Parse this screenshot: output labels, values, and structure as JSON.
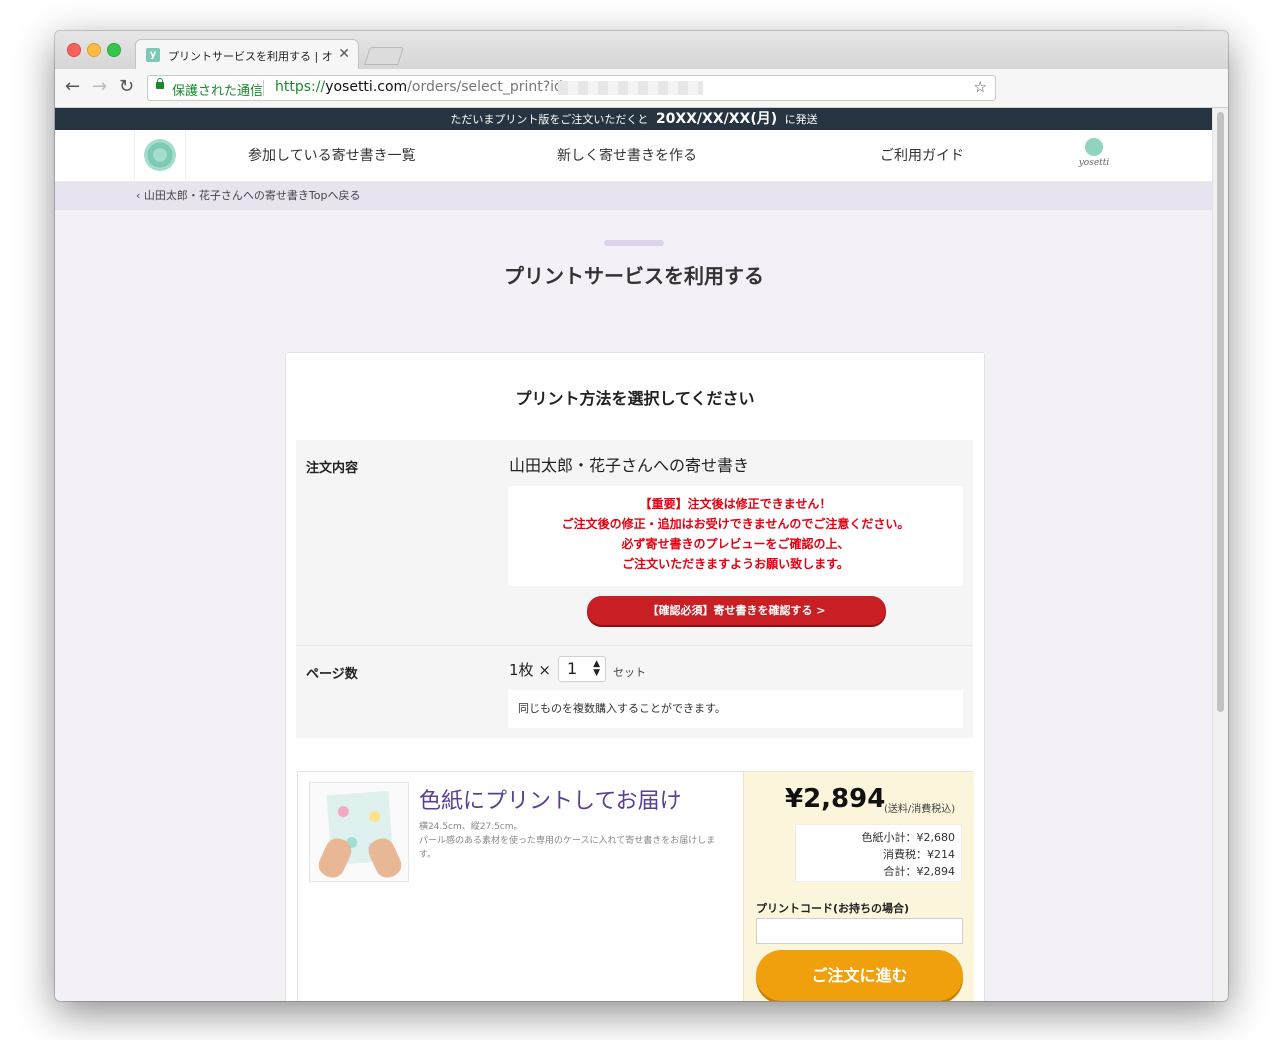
{
  "browser": {
    "tab_title": "プリントサービスを利用する | オン",
    "favicon_letter": "y",
    "secure_label": "保護された通信",
    "url_scheme": "https://",
    "url_host": "yosetti.com",
    "url_path": "/orders/select_print?id=",
    "icons": {
      "back": "back-arrow-icon",
      "forward": "forward-arrow-icon",
      "reload": "reload-icon",
      "lock": "lock-icon",
      "bookmark": "star-icon",
      "close": "close-icon"
    }
  },
  "announcement": {
    "prefix": "ただいまプリント版をご注文いただくと",
    "date": "20XX/XX/XX(月)",
    "suffix": "に発送"
  },
  "nav": {
    "joined": "参加している寄せ書き一覧",
    "create": "新しく寄せ書きを作る",
    "guide": "ご利用ガイド",
    "brand": "yosetti"
  },
  "breadcrumb": {
    "back_label": "山田太郎・花子さんへの寄せ書きTopへ戻る"
  },
  "page": {
    "title": "プリントサービスを利用する"
  },
  "card": {
    "heading": "プリント方法を選択してください",
    "order": {
      "label": "注文内容",
      "name": "山田太郎・花子さんへの寄せ書き",
      "warnings": [
        "【重要】注文後は修正できません！",
        "ご注文後の修正・追加はお受けできませんのでご注意ください。",
        "必ず寄せ書きのプレビューをご確認の上、",
        "ご注文いただきますようお願い致します。"
      ],
      "confirm_button": "【確認必須】寄せ書きを確認する >"
    },
    "pages": {
      "label": "ページ数",
      "sheets": "1枚",
      "times": "×",
      "quantity": "1",
      "set_label": "セット",
      "note": "同じものを複数購入することができます。"
    },
    "product": {
      "name": "色紙にプリントしてお届け",
      "desc_size": "横24.5cm、縦27.5cm。",
      "desc_detail": "パール感のある素材を使った専用のケースに入れて寄せ書きをお届けします。",
      "price": "¥2,894",
      "price_note": "(送料/消費税込)",
      "subtotal": "色紙小計：¥2,680",
      "tax": "消費税：¥214",
      "total": "合計：¥2,894",
      "code_label": "プリントコード(お持ちの場合)",
      "code_value": "",
      "order_button": "ご注文に進む"
    }
  },
  "colors": {
    "announce_bg": "#253440",
    "warning": "#e60012",
    "confirm_button": "#c81e24",
    "order_button": "#f0a00c",
    "product_name": "#5b3f96",
    "price_panel": "#fbf5dc"
  }
}
